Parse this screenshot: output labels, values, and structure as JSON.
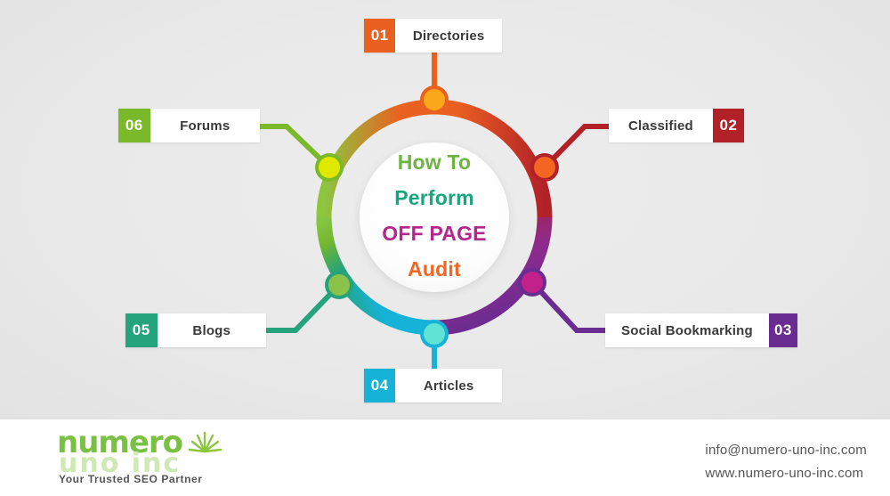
{
  "center": {
    "lines": [
      {
        "text": "How To",
        "color": "#6cb33f"
      },
      {
        "text": "Perform",
        "color": "#1aa67d"
      },
      {
        "text": "OFF PAGE",
        "color": "#b5258e"
      },
      {
        "text": "Audit",
        "color": "#f26522"
      }
    ]
  },
  "steps": [
    {
      "number": "01",
      "label": "Directories",
      "color": "#ea6020",
      "node_fill": "#faa71b",
      "side": "left",
      "position": "top"
    },
    {
      "number": "02",
      "label": "Classified",
      "color": "#b22028",
      "node_fill": "#f26522",
      "side": "right",
      "position": "upper-right"
    },
    {
      "number": "03",
      "label": "Social Bookmarking",
      "color": "#6b2c91",
      "node_fill": "#c2208a",
      "side": "right",
      "position": "lower-right"
    },
    {
      "number": "04",
      "label": "Articles",
      "color": "#16b2d8",
      "node_fill": "#5fe3d4",
      "side": "left",
      "position": "bottom"
    },
    {
      "number": "05",
      "label": "Blogs",
      "color": "#25a37a",
      "node_fill": "#8bc34a",
      "side": "left",
      "position": "lower-left"
    },
    {
      "number": "06",
      "label": "Forums",
      "color": "#7ab929",
      "node_fill": "#e1e800",
      "side": "left",
      "position": "upper-left"
    }
  ],
  "ring": {
    "stops": [
      {
        "offset": "0%",
        "color": "#faa71b"
      },
      {
        "offset": "14%",
        "color": "#ea6020"
      },
      {
        "offset": "30%",
        "color": "#b22028"
      },
      {
        "offset": "44%",
        "color": "#6b2c91"
      },
      {
        "offset": "52%",
        "color": "#c2208a"
      },
      {
        "offset": "62%",
        "color": "#16b2d8"
      },
      {
        "offset": "76%",
        "color": "#25a37a"
      },
      {
        "offset": "88%",
        "color": "#8cc63f"
      },
      {
        "offset": "100%",
        "color": "#faa71b"
      }
    ]
  },
  "footer": {
    "logo": {
      "main": "numero",
      "sub": "uno inc",
      "tagline": "Your Trusted SEO Partner",
      "main_color": "#7ac143",
      "sub_color": "#cfe8b4"
    },
    "contact": {
      "email": "info@numero-uno-inc.com",
      "website": "www.numero-uno-inc.com"
    }
  }
}
